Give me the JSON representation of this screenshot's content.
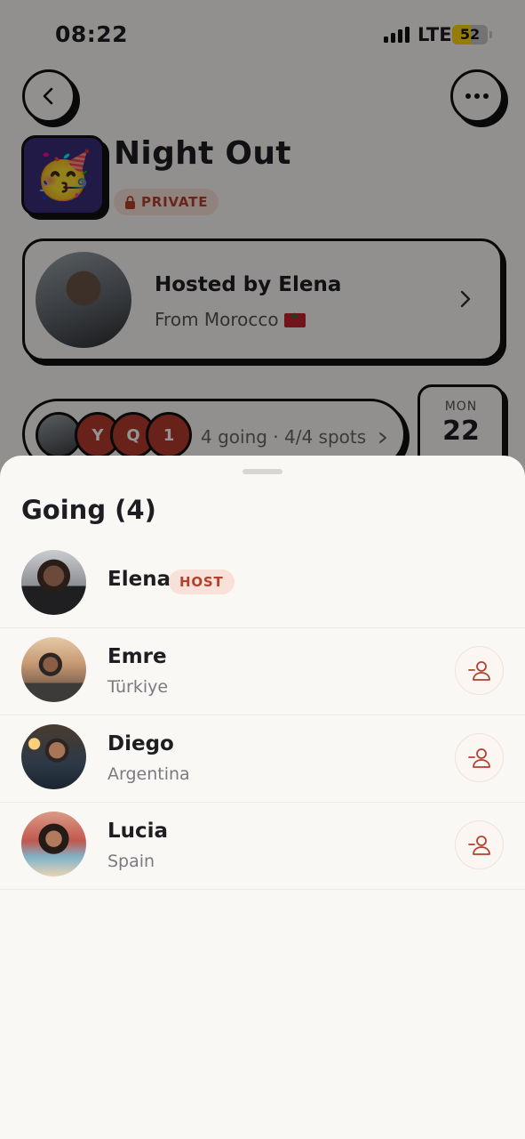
{
  "status_bar": {
    "time": "08:22",
    "network": "LTE",
    "battery": "52",
    "battery_level": 0.52
  },
  "event": {
    "emoji": "🥳",
    "title": "Night Out",
    "privacy": "PRIVATE"
  },
  "host_card": {
    "name_line": "Hosted by Elena",
    "from_line": "From Morocco"
  },
  "attendance": {
    "mini_avatars": [
      "Y",
      "Q",
      "1"
    ],
    "summary": "4 going · 4/4 spots"
  },
  "date": {
    "dow": "MON",
    "day": "22"
  },
  "sheet": {
    "title": "Going (4)",
    "host_badge": "HOST",
    "members": [
      {
        "name": "Elena",
        "country": ""
      },
      {
        "name": "Emre",
        "country": "Türkiye"
      },
      {
        "name": "Diego",
        "country": "Argentina"
      },
      {
        "name": "Lucia",
        "country": "Spain"
      }
    ]
  },
  "icons": [
    "chevron-left-icon",
    "more-horizontal-icon",
    "lock-icon",
    "chevron-right-icon",
    "remove-user-icon"
  ],
  "colors": {
    "accent": "#b3402e",
    "badge_bg": "#f8e1d8",
    "sheet_bg": "#faf8f4",
    "ink": "#111111"
  }
}
